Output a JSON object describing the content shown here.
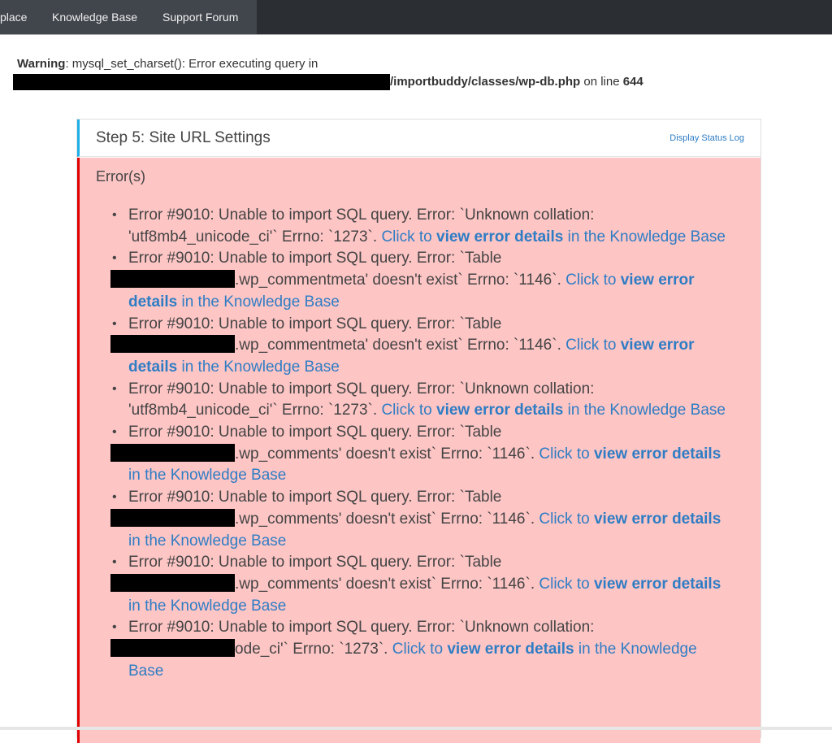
{
  "nav": {
    "items": [
      {
        "label": "place"
      },
      {
        "label": "Knowledge Base"
      },
      {
        "label": "Support Forum"
      }
    ]
  },
  "warning": {
    "label": "Warning",
    "message": ": mysql_set_charset(): Error executing query in",
    "file_path": "/importbuddy/classes/wp-db.php",
    "on_line_text": " on line ",
    "line_number": "644"
  },
  "panel": {
    "title": "Step 5: Site URL Settings",
    "status_log_link": "Display Status Log",
    "errors_heading": "Error(s)",
    "link_prefix": "Click to ",
    "link_bold": "view error details",
    "link_suffix": " in the Knowledge Base",
    "errors": [
      {
        "text": "Error #9010: Unable to import SQL query. Error: `Unknown collation: 'utf8mb4_unicode_ci'` Errno: `1273`.",
        "redacted": false
      },
      {
        "text_before": "Error #9010: Unable to import SQL query. Error: `Table",
        "text_after": ".wp_commentmeta' doesn't exist` Errno: `1146`.",
        "redacted": true
      },
      {
        "text_before": "Error #9010: Unable to import SQL query. Error: `Table",
        "text_after": ".wp_commentmeta' doesn't exist` Errno: `1146`.",
        "redacted": true
      },
      {
        "text": "Error #9010: Unable to import SQL query. Error: `Unknown collation: 'utf8mb4_unicode_ci'` Errno: `1273`.",
        "redacted": false
      },
      {
        "text_before": "Error #9010: Unable to import SQL query. Error: `Table",
        "text_after": ".wp_comments' doesn't exist` Errno: `1146`.",
        "redacted": true
      },
      {
        "text_before": "Error #9010: Unable to import SQL query. Error: `Table",
        "text_after": ".wp_comments' doesn't exist` Errno: `1146`.",
        "redacted": true
      },
      {
        "text_before": "Error #9010: Unable to import SQL query. Error: `Table",
        "text_after": ".wp_comments' doesn't exist` Errno: `1146`.",
        "redacted": true
      },
      {
        "text_before": "Error #9010: Unable to import SQL query. Error: `Unknown collation:",
        "text_after": "ode_ci'` Errno: `1273`.",
        "redacted": true
      }
    ]
  },
  "colors": {
    "nav_bg": "#2b2f34",
    "nav_active_bg": "#41454c",
    "header_accent": "#1ab0e8",
    "error_accent": "#e00000",
    "error_bg": "#fec5c5",
    "link": "#2e7dc4"
  }
}
